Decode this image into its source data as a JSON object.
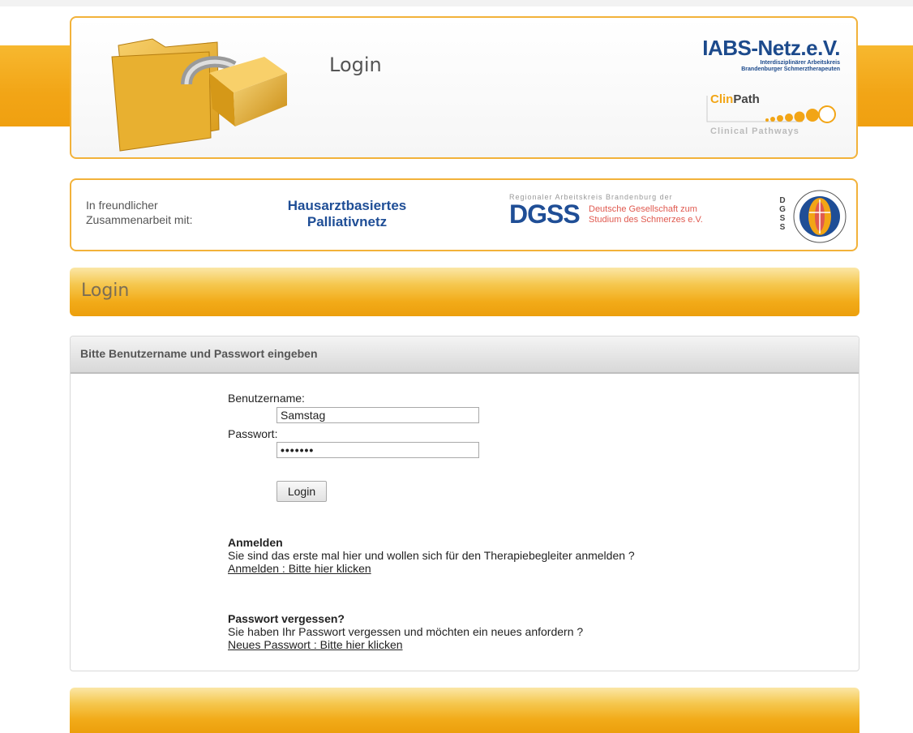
{
  "header": {
    "title": "Login",
    "org_name": "IABS-Netz.e.V.",
    "org_subtitle_1": "Interdisziplinärer Arbeitskreis",
    "org_subtitle_2": "Brandenburger Schmerztherapeuten",
    "clinpath_clin": "Clin",
    "clinpath_path": "Path",
    "clinpath_sub": "Clinical Pathways"
  },
  "partners": {
    "intro_line1": "In freundlicher",
    "intro_line2": "Zusammenarbeit mit:",
    "hap_line1": "Hausarztbasiertes",
    "hap_line2": "Palliativnetz",
    "dgss_top": "Regionaler Arbeitskreis Brandenburg der",
    "dgss_abbr": "DGSS",
    "dgss_line1": "Deutsche Gesellschaft zum",
    "dgss_line2": "Studium des Schmerzes e.V.",
    "dgss_vertical": [
      "D",
      "G",
      "S",
      "S"
    ]
  },
  "section_title": "Login",
  "form": {
    "panel_title": "Bitte Benutzername und Passwort eingeben",
    "username_label": "Benutzername:",
    "username_value": "Samstag",
    "password_label": "Passwort:",
    "password_value": "•••••••",
    "submit_label": "Login"
  },
  "register": {
    "title": "Anmelden",
    "text": "Sie sind das erste mal hier und wollen sich für den Therapiebegleiter anmelden ?",
    "link": "Anmelden : Bitte hier klicken"
  },
  "forgot": {
    "title": "Passwort vergessen?",
    "text": "Sie haben Ihr Passwort vergessen und möchten ein neues anfordern ?",
    "link": "Neues Passwort : Bitte hier klicken"
  },
  "colors": {
    "accent_orange": "#f2a516",
    "brand_blue": "#1f4e96",
    "dgss_red": "#e05a50"
  }
}
